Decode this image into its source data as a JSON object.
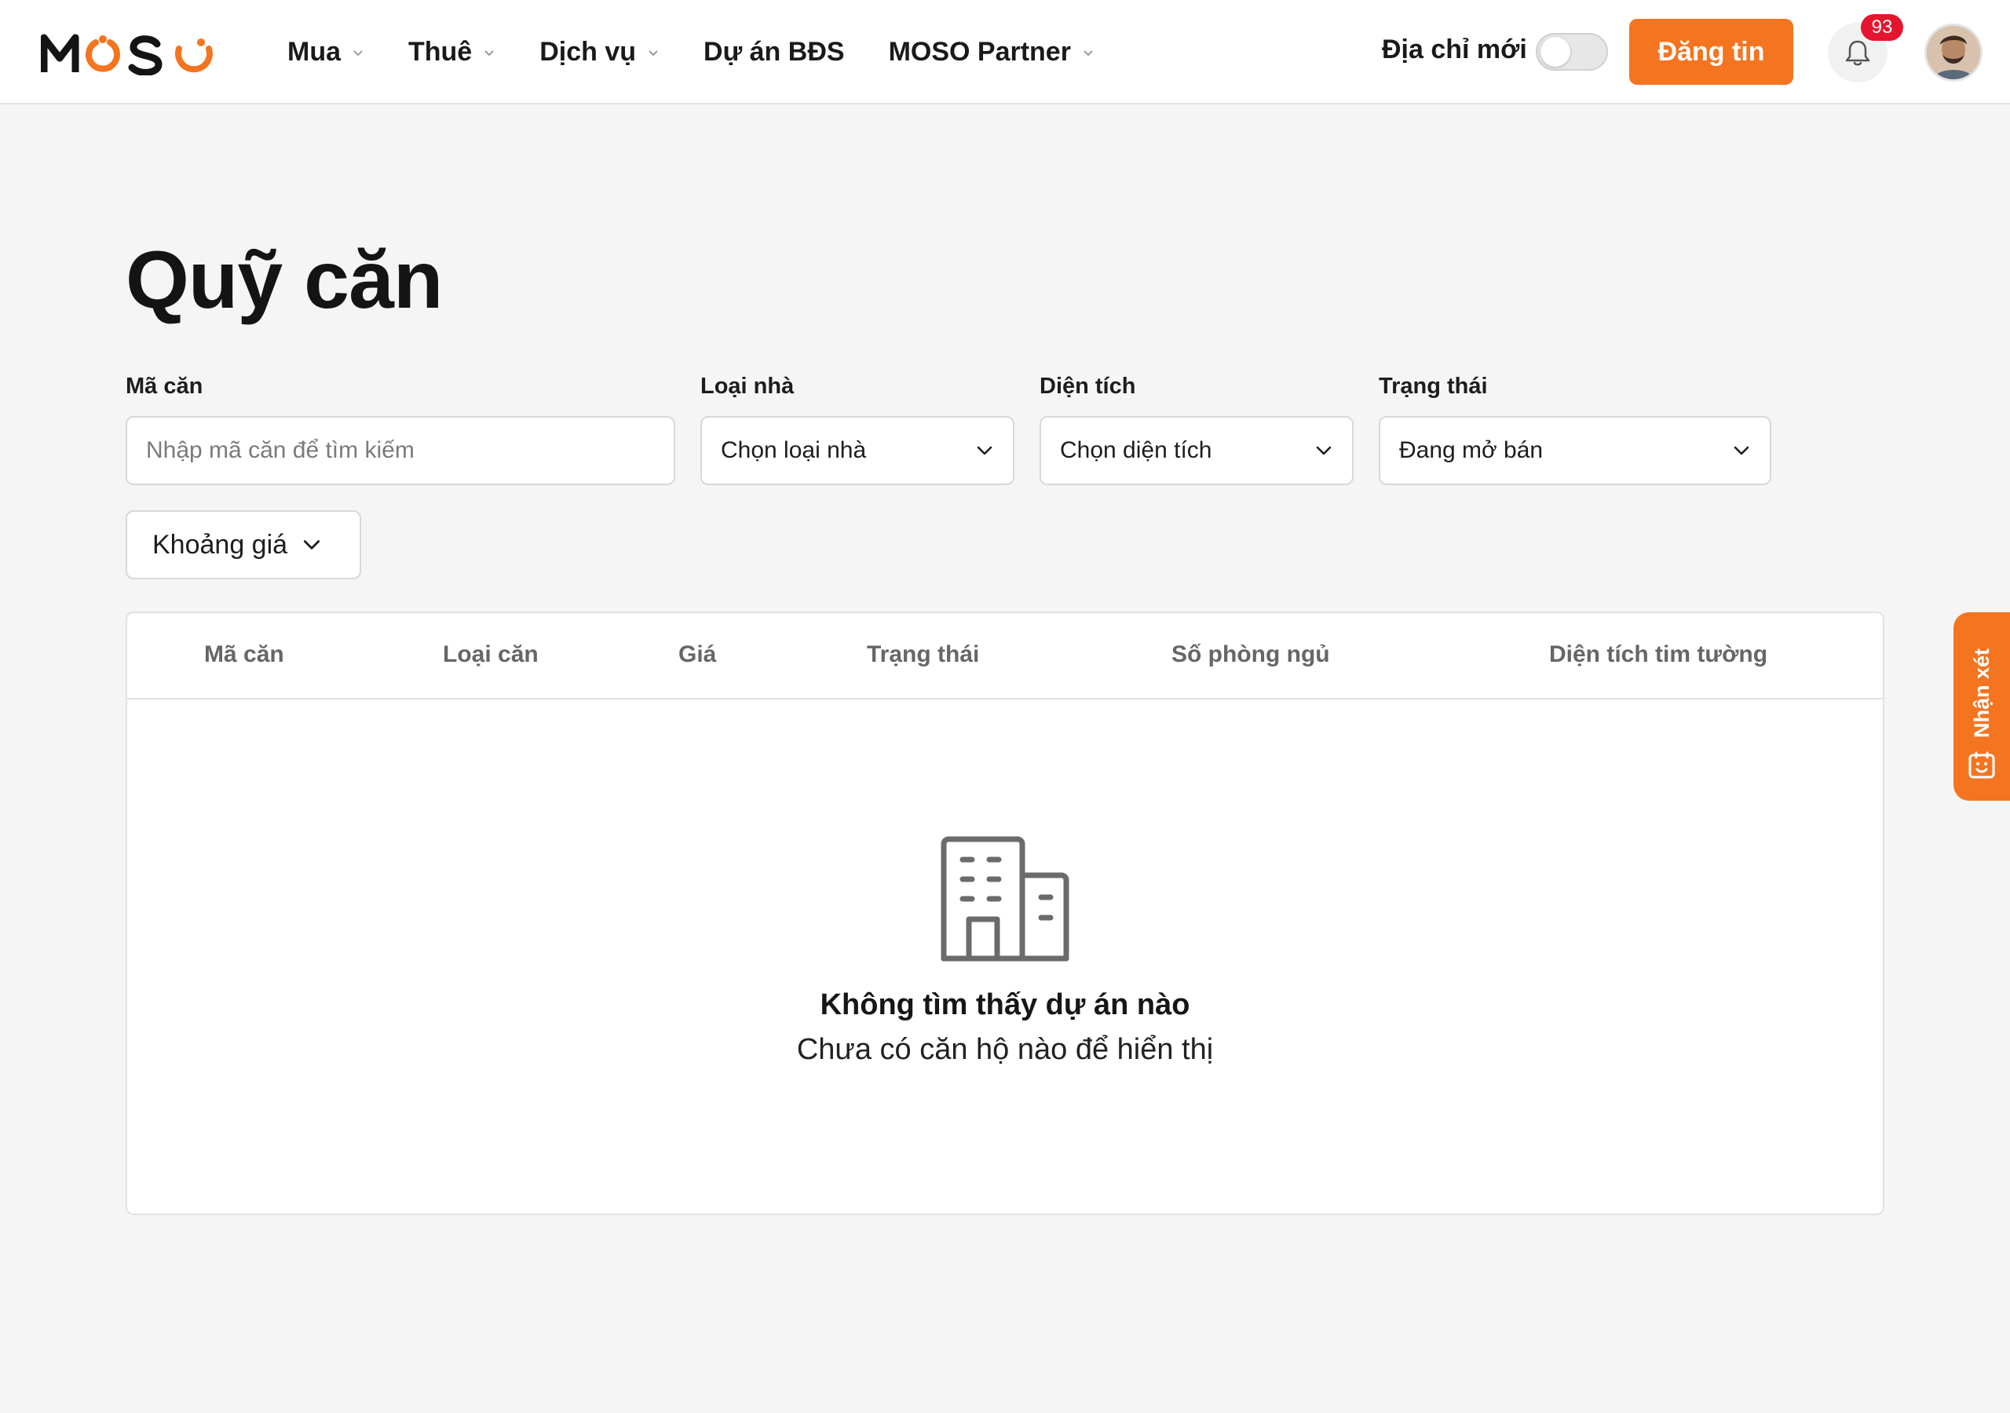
{
  "header": {
    "logo_text": "MOSO",
    "nav": [
      {
        "label": "Mua",
        "has_dropdown": true
      },
      {
        "label": "Thuê",
        "has_dropdown": true
      },
      {
        "label": "Dịch vụ",
        "has_dropdown": true
      },
      {
        "label": "Dự án BĐS",
        "has_dropdown": false
      },
      {
        "label": "MOSO Partner",
        "has_dropdown": true
      }
    ],
    "new_address_label": "Địa chỉ mới",
    "new_address_toggle_on": false,
    "post_button": "Đăng tin",
    "notification_count": "93",
    "accent_color": "#f47420",
    "badge_color": "#e5152f"
  },
  "page": {
    "title": "Quỹ căn"
  },
  "filters": {
    "code": {
      "label": "Mã căn",
      "placeholder": "Nhập mã căn để tìm kiếm",
      "value": ""
    },
    "house_type": {
      "label": "Loại nhà",
      "value": "Chọn loại nhà"
    },
    "area": {
      "label": "Diện tích",
      "value": "Chọn diện tích"
    },
    "status": {
      "label": "Trạng thái",
      "value": "Đang mở bán"
    },
    "price_range": {
      "label": "Khoảng giá"
    }
  },
  "table": {
    "columns": [
      "Mã căn",
      "Loại căn",
      "Giá",
      "Trạng thái",
      "Số phòng ngủ",
      "Diện tích tim tường"
    ],
    "rows": [],
    "empty_title": "Không tìm thấy dự án nào",
    "empty_subtitle": "Chưa có căn hộ nào để hiển thị"
  },
  "feedback_tab": {
    "label": "Nhận xét"
  }
}
